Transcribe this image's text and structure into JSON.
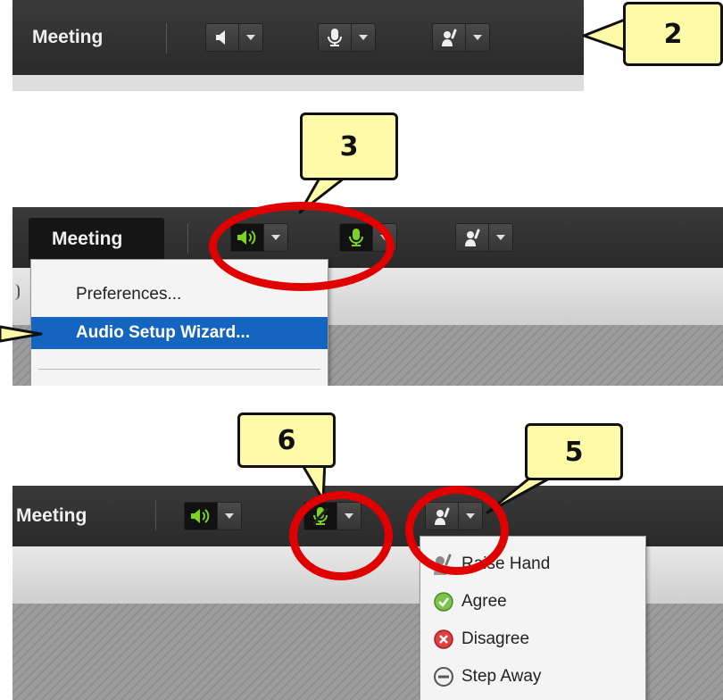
{
  "panels": {
    "top": {
      "meeting_label": "Meeting"
    },
    "middle": {
      "meeting_label": "Meeting",
      "menu": [
        {
          "label": "Preferences...",
          "selected": false
        },
        {
          "label": "Audio Setup Wizard...",
          "selected": true
        }
      ]
    },
    "bottom": {
      "meeting_label": "Meeting",
      "status_menu": [
        {
          "label": "Raise Hand",
          "icon": "raise-hand-icon"
        },
        {
          "label": "Agree",
          "icon": "agree-check-icon"
        },
        {
          "label": "Disagree",
          "icon": "disagree-x-icon"
        },
        {
          "label": "Step Away",
          "icon": "step-away-icon"
        }
      ]
    }
  },
  "callouts": {
    "c2": "2",
    "c3": "3",
    "c5": "5",
    "c6": "6"
  },
  "colors": {
    "callout_fill": "#fffaa8",
    "ring": "#e00000",
    "active_green": "#7cd321",
    "menu_highlight": "#1565c0"
  }
}
